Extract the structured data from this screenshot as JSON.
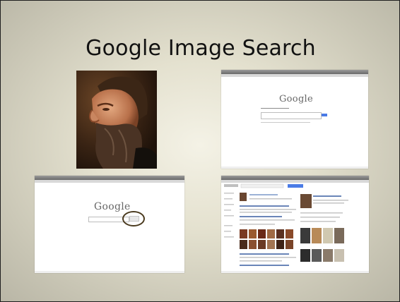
{
  "slide": {
    "title": "Google Image Search"
  },
  "screenshots": {
    "logo_text": "Google"
  },
  "colors": {
    "slide_bg_center": "#f4f2e6",
    "slide_bg_edge": "#b9b6a6",
    "highlight_oval": "#4a3a1e",
    "search_button_blue": "#4a7be6"
  }
}
